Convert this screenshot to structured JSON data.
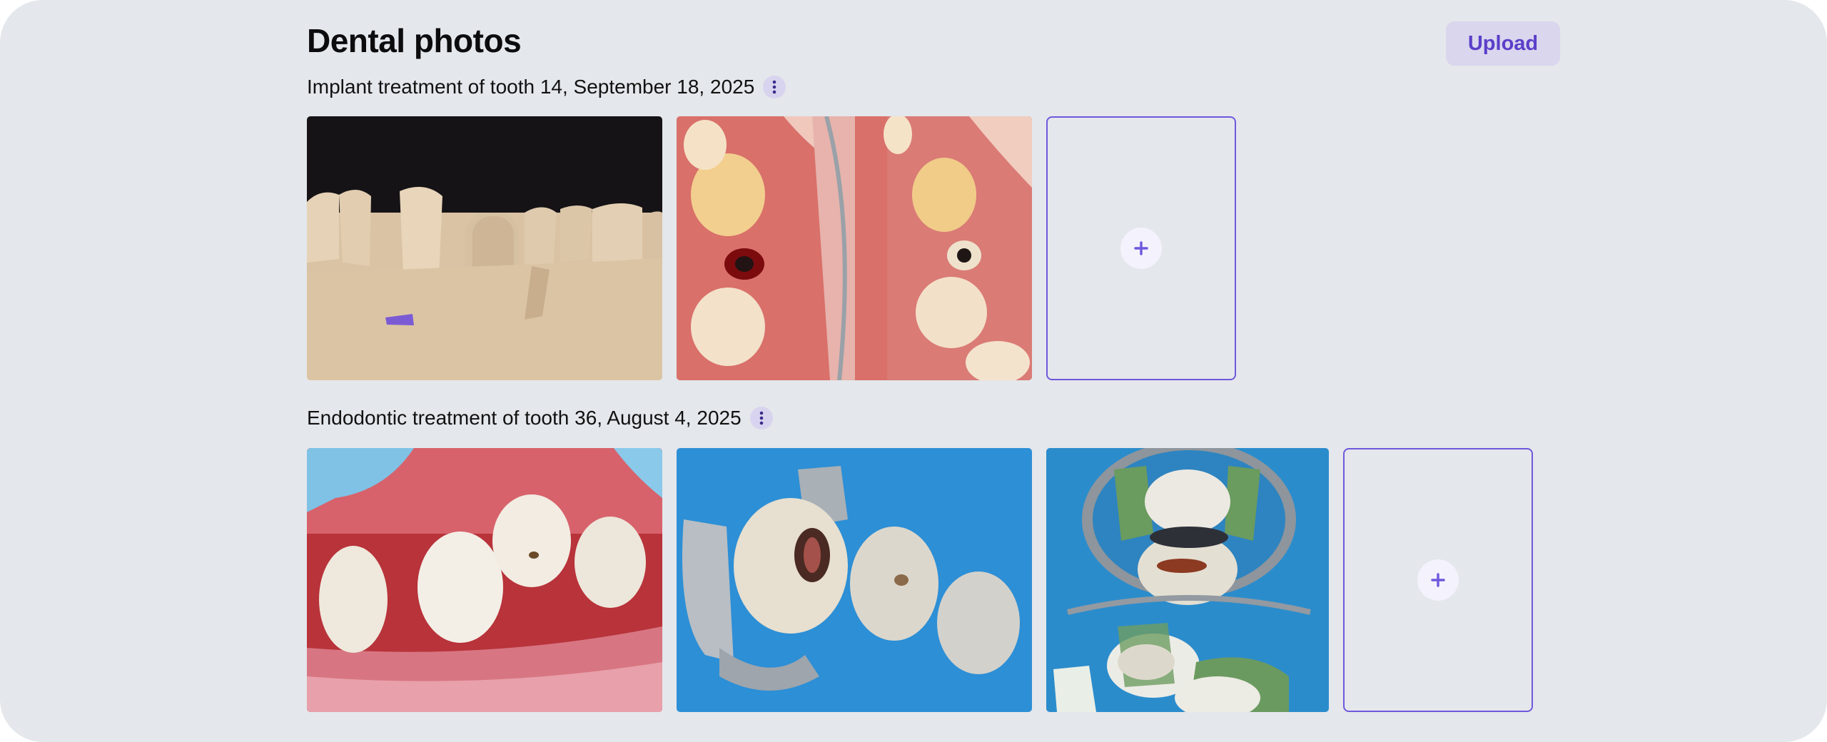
{
  "page": {
    "title": "Dental photos",
    "upload_label": "Upload"
  },
  "sections": [
    {
      "label": "Implant treatment of tooth 14, September 18, 2025",
      "photos": [
        "dental-model-implant-photo",
        "implant-site-before-after-photo"
      ]
    },
    {
      "label": "Endodontic treatment of tooth 36, August 4, 2025",
      "photos": [
        "molars-intraoral-photo",
        "rubber-dam-access-cavity-photo",
        "rubber-dam-mirror-view-photo"
      ]
    }
  ],
  "icons": {
    "more": "kebab-vertical-icon",
    "add": "plus-icon"
  },
  "colors": {
    "accent": "#6e58dd",
    "upload_bg": "#d9d6ee",
    "upload_text": "#5b3fc9",
    "panel_bg": "#e4e7eb"
  }
}
